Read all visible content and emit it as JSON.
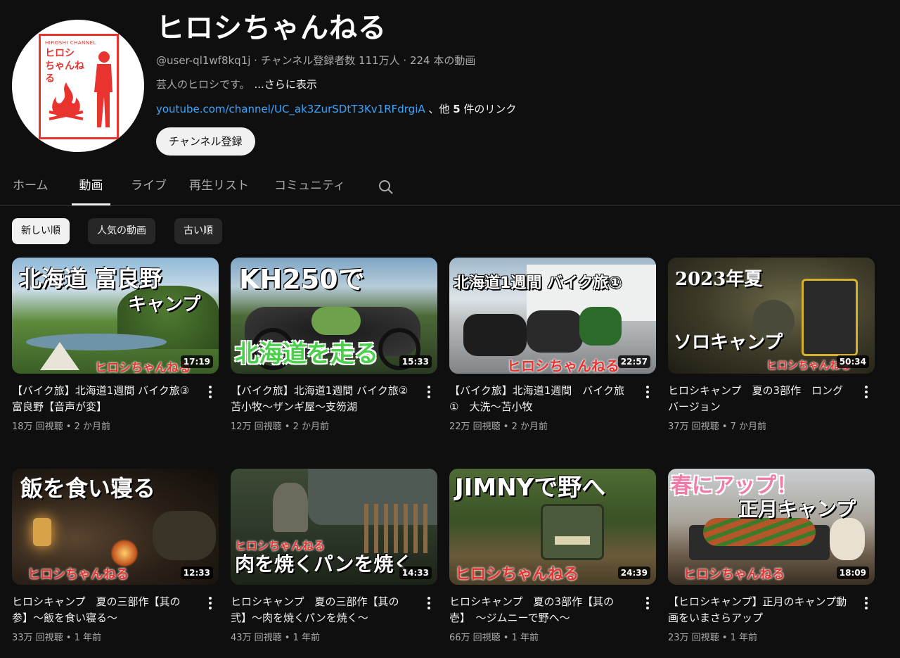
{
  "channel": {
    "avatar_tag": "HIROSHI CHANNEL",
    "avatar_name": "ヒロシ ちゃんねる",
    "title": "ヒロシちゃんねる",
    "meta": "@user-ql1wf8kq1j · チャンネル登録者数 111万人 · 224 本の動画",
    "description": "芸人のヒロシです。",
    "more": "...さらに表示",
    "link_url": "youtube.com/channel/UC_ak3ZurSDtT3Kv1RFdrgiA",
    "link_suffix_pre": " 、他 ",
    "link_count": "5",
    "link_suffix_post": " 件のリンク",
    "subscribe_label": "チャンネル登録"
  },
  "tabs": [
    {
      "label": "ホーム"
    },
    {
      "label": "動画"
    },
    {
      "label": "ライブ"
    },
    {
      "label": "再生リスト"
    },
    {
      "label": "コミュニティ"
    }
  ],
  "chips": [
    {
      "label": "新しい順"
    },
    {
      "label": "人気の動画"
    },
    {
      "label": "古い順"
    }
  ],
  "videos": [
    {
      "thumb_text": "北海道 富良野",
      "thumb_sub": "キャンプ",
      "watermark": "ヒロシちゃんねる",
      "duration": "17:19",
      "title": "【バイク旅】北海道1週間 バイク旅③　富良野【音声が変】",
      "meta": "18万 回視聴 • 2 か月前"
    },
    {
      "thumb_text": "KH250で",
      "thumb_sub": "北海道を走る",
      "watermark": "",
      "duration": "15:33",
      "title": "【バイク旅】北海道1週間 バイク旅②　苫小牧〜ザンギ屋〜支笏湖",
      "meta": "12万 回視聴 • 2 か月前"
    },
    {
      "thumb_text": "北海道1週間 バイク旅①",
      "thumb_sub": "",
      "watermark": "ヒロシちゃんねる",
      "duration": "22:57",
      "title": "【バイク旅】北海道1週間　バイク旅①　大洗〜苫小牧",
      "meta": "22万 回視聴 • 2 か月前"
    },
    {
      "thumb_text": "2023年夏",
      "thumb_sub": "ソロキャンプ",
      "watermark": "ヒロシちゃんねる",
      "duration": "50:34",
      "title": "ヒロシキャンプ　夏の3部作　ロングバージョン",
      "meta": "37万 回視聴 • 7 か月前"
    },
    {
      "thumb_text": "飯を食い寝る",
      "thumb_sub": "",
      "watermark": "ヒロシちゃんねる",
      "duration": "12:33",
      "title": "ヒロシキャンプ　夏の三部作【其の参】〜飯を食い寝る〜",
      "meta": "33万 回視聴 • 1 年前"
    },
    {
      "thumb_text": "ヒロシちゃんねる",
      "thumb_sub": "肉を焼くパンを焼く",
      "watermark": "",
      "duration": "14:33",
      "title": "ヒロシキャンプ　夏の三部作【其の弐】〜肉を焼くパンを焼く〜",
      "meta": "43万 回視聴 • 1 年前"
    },
    {
      "thumb_text": "JIMNYで野へ",
      "thumb_sub": "",
      "watermark": "ヒロシちゃんねる",
      "duration": "24:39",
      "title": "ヒロシキャンプ　夏の3部作【其の壱】　〜ジムニーで野へ〜",
      "meta": "66万 回視聴 • 1 年前"
    },
    {
      "thumb_text": "春にアップ！",
      "thumb_sub": "正月キャンプ",
      "watermark": "ヒロシちゃんねる",
      "duration": "18:09",
      "title": "【ヒロシキャンプ】正月のキャンプ動画をいまさらアップ",
      "meta": "23万 回視聴 • 1 年前"
    }
  ]
}
